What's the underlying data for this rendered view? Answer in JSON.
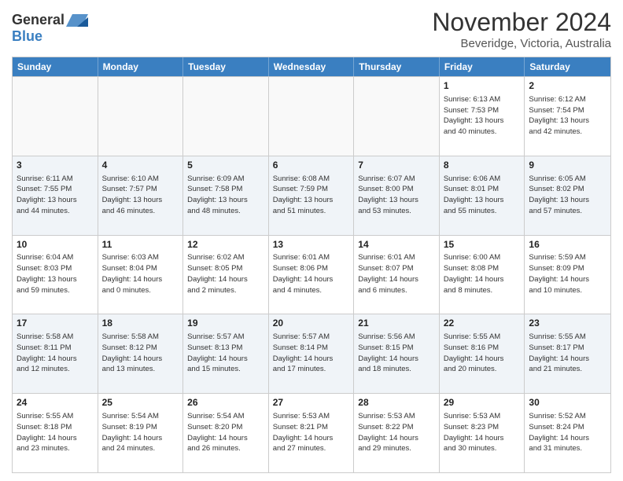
{
  "header": {
    "logo": {
      "general": "General",
      "blue": "Blue"
    },
    "title": "November 2024",
    "location": "Beveridge, Victoria, Australia"
  },
  "calendar": {
    "days_of_week": [
      "Sunday",
      "Monday",
      "Tuesday",
      "Wednesday",
      "Thursday",
      "Friday",
      "Saturday"
    ],
    "weeks": [
      [
        {
          "day": "",
          "info": "",
          "empty": true
        },
        {
          "day": "",
          "info": "",
          "empty": true
        },
        {
          "day": "",
          "info": "",
          "empty": true
        },
        {
          "day": "",
          "info": "",
          "empty": true
        },
        {
          "day": "",
          "info": "",
          "empty": true
        },
        {
          "day": "1",
          "info": "Sunrise: 6:13 AM\nSunset: 7:53 PM\nDaylight: 13 hours\nand 40 minutes."
        },
        {
          "day": "2",
          "info": "Sunrise: 6:12 AM\nSunset: 7:54 PM\nDaylight: 13 hours\nand 42 minutes."
        }
      ],
      [
        {
          "day": "3",
          "info": "Sunrise: 6:11 AM\nSunset: 7:55 PM\nDaylight: 13 hours\nand 44 minutes."
        },
        {
          "day": "4",
          "info": "Sunrise: 6:10 AM\nSunset: 7:57 PM\nDaylight: 13 hours\nand 46 minutes."
        },
        {
          "day": "5",
          "info": "Sunrise: 6:09 AM\nSunset: 7:58 PM\nDaylight: 13 hours\nand 48 minutes."
        },
        {
          "day": "6",
          "info": "Sunrise: 6:08 AM\nSunset: 7:59 PM\nDaylight: 13 hours\nand 51 minutes."
        },
        {
          "day": "7",
          "info": "Sunrise: 6:07 AM\nSunset: 8:00 PM\nDaylight: 13 hours\nand 53 minutes."
        },
        {
          "day": "8",
          "info": "Sunrise: 6:06 AM\nSunset: 8:01 PM\nDaylight: 13 hours\nand 55 minutes."
        },
        {
          "day": "9",
          "info": "Sunrise: 6:05 AM\nSunset: 8:02 PM\nDaylight: 13 hours\nand 57 minutes."
        }
      ],
      [
        {
          "day": "10",
          "info": "Sunrise: 6:04 AM\nSunset: 8:03 PM\nDaylight: 13 hours\nand 59 minutes."
        },
        {
          "day": "11",
          "info": "Sunrise: 6:03 AM\nSunset: 8:04 PM\nDaylight: 14 hours\nand 0 minutes."
        },
        {
          "day": "12",
          "info": "Sunrise: 6:02 AM\nSunset: 8:05 PM\nDaylight: 14 hours\nand 2 minutes."
        },
        {
          "day": "13",
          "info": "Sunrise: 6:01 AM\nSunset: 8:06 PM\nDaylight: 14 hours\nand 4 minutes."
        },
        {
          "day": "14",
          "info": "Sunrise: 6:01 AM\nSunset: 8:07 PM\nDaylight: 14 hours\nand 6 minutes."
        },
        {
          "day": "15",
          "info": "Sunrise: 6:00 AM\nSunset: 8:08 PM\nDaylight: 14 hours\nand 8 minutes."
        },
        {
          "day": "16",
          "info": "Sunrise: 5:59 AM\nSunset: 8:09 PM\nDaylight: 14 hours\nand 10 minutes."
        }
      ],
      [
        {
          "day": "17",
          "info": "Sunrise: 5:58 AM\nSunset: 8:11 PM\nDaylight: 14 hours\nand 12 minutes."
        },
        {
          "day": "18",
          "info": "Sunrise: 5:58 AM\nSunset: 8:12 PM\nDaylight: 14 hours\nand 13 minutes."
        },
        {
          "day": "19",
          "info": "Sunrise: 5:57 AM\nSunset: 8:13 PM\nDaylight: 14 hours\nand 15 minutes."
        },
        {
          "day": "20",
          "info": "Sunrise: 5:57 AM\nSunset: 8:14 PM\nDaylight: 14 hours\nand 17 minutes."
        },
        {
          "day": "21",
          "info": "Sunrise: 5:56 AM\nSunset: 8:15 PM\nDaylight: 14 hours\nand 18 minutes."
        },
        {
          "day": "22",
          "info": "Sunrise: 5:55 AM\nSunset: 8:16 PM\nDaylight: 14 hours\nand 20 minutes."
        },
        {
          "day": "23",
          "info": "Sunrise: 5:55 AM\nSunset: 8:17 PM\nDaylight: 14 hours\nand 21 minutes."
        }
      ],
      [
        {
          "day": "24",
          "info": "Sunrise: 5:55 AM\nSunset: 8:18 PM\nDaylight: 14 hours\nand 23 minutes."
        },
        {
          "day": "25",
          "info": "Sunrise: 5:54 AM\nSunset: 8:19 PM\nDaylight: 14 hours\nand 24 minutes."
        },
        {
          "day": "26",
          "info": "Sunrise: 5:54 AM\nSunset: 8:20 PM\nDaylight: 14 hours\nand 26 minutes."
        },
        {
          "day": "27",
          "info": "Sunrise: 5:53 AM\nSunset: 8:21 PM\nDaylight: 14 hours\nand 27 minutes."
        },
        {
          "day": "28",
          "info": "Sunrise: 5:53 AM\nSunset: 8:22 PM\nDaylight: 14 hours\nand 29 minutes."
        },
        {
          "day": "29",
          "info": "Sunrise: 5:53 AM\nSunset: 8:23 PM\nDaylight: 14 hours\nand 30 minutes."
        },
        {
          "day": "30",
          "info": "Sunrise: 5:52 AM\nSunset: 8:24 PM\nDaylight: 14 hours\nand 31 minutes."
        }
      ]
    ]
  }
}
